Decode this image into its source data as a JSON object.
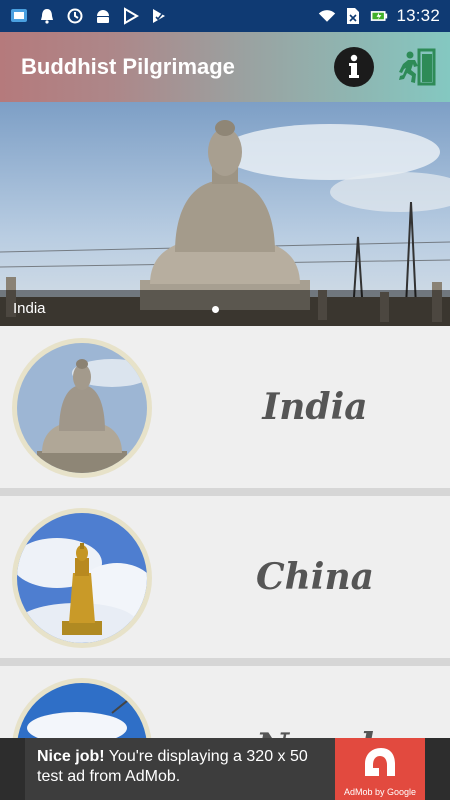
{
  "status_bar": {
    "time": "13:32",
    "left_icons": [
      "screen-cast-icon",
      "bell-icon",
      "sync-icon",
      "android-icon",
      "play-store-icon",
      "play-store-icon-2"
    ],
    "right_icons": [
      "wifi-icon",
      "no-sim-icon",
      "battery-icon"
    ]
  },
  "app_bar": {
    "title": "Buddhist Pilgrimage",
    "actions": [
      "info-icon",
      "exit-icon"
    ]
  },
  "hero": {
    "caption": "India",
    "slide_count": 1,
    "active_slide": 1
  },
  "places": [
    {
      "name": "India"
    },
    {
      "name": "China"
    },
    {
      "name": "Nepal"
    }
  ],
  "ad": {
    "headline": "Nice job!",
    "body": " You're displaying a 320 x 50 test ad from AdMob.",
    "logo_caption": "AdMob by Google"
  },
  "colors": {
    "status_bar": "#0f3a73",
    "app_bar_start": "#b57a7c",
    "app_bar_end": "#84c8c1",
    "exit_icon": "#2e8b57",
    "ad_logo": "#e24a3f"
  }
}
